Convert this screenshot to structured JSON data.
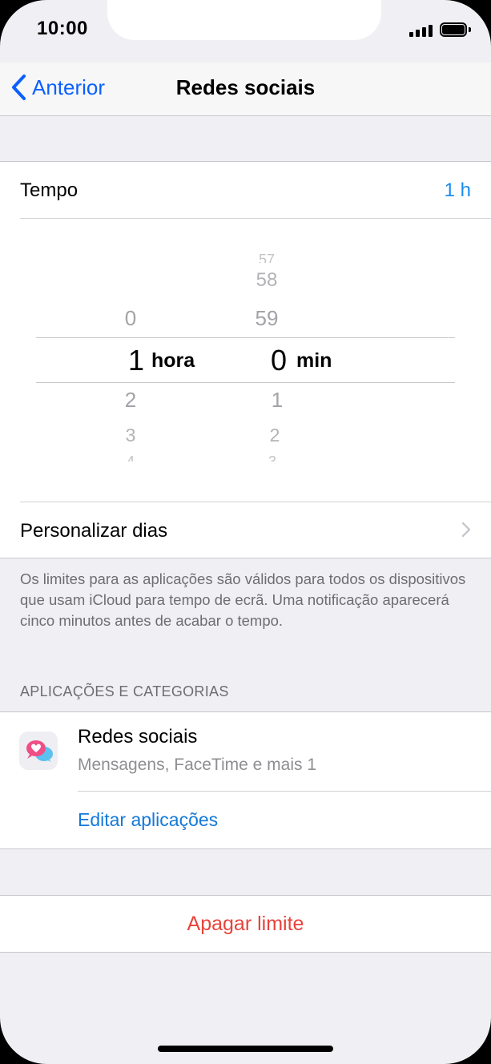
{
  "status_bar": {
    "time": "10:00"
  },
  "nav": {
    "back_label": "Anterior",
    "title": "Redes sociais"
  },
  "tempo": {
    "label": "Tempo",
    "value": "1 h"
  },
  "picker": {
    "hours": {
      "above": [
        "0"
      ],
      "selected": "1",
      "below": [
        "2",
        "3",
        "4"
      ],
      "unit": "hora"
    },
    "minutes": {
      "above": [
        "57",
        "58",
        "59"
      ],
      "selected": "0",
      "below": [
        "1",
        "2",
        "3"
      ],
      "unit": "min"
    }
  },
  "personalizar": {
    "label": "Personalizar dias"
  },
  "footnote": "Os limites para as aplicações são válidos para todos os dispositivos que usam iCloud para tempo de ecrã. Uma notificação aparecerá cinco minutos antes de acabar o tempo.",
  "section_header": "APLICAÇÕES E CATEGORIAS",
  "app": {
    "name": "Redes sociais",
    "subtitle": "Mensagens, FaceTime e mais 1",
    "edit_label": "Editar aplicações",
    "icon": "social-bubbles-icon"
  },
  "delete": {
    "label": "Apagar limite"
  },
  "colors": {
    "accent": "#1a8cf0",
    "destructive": "#e8433b",
    "back": "#0a60ff"
  }
}
